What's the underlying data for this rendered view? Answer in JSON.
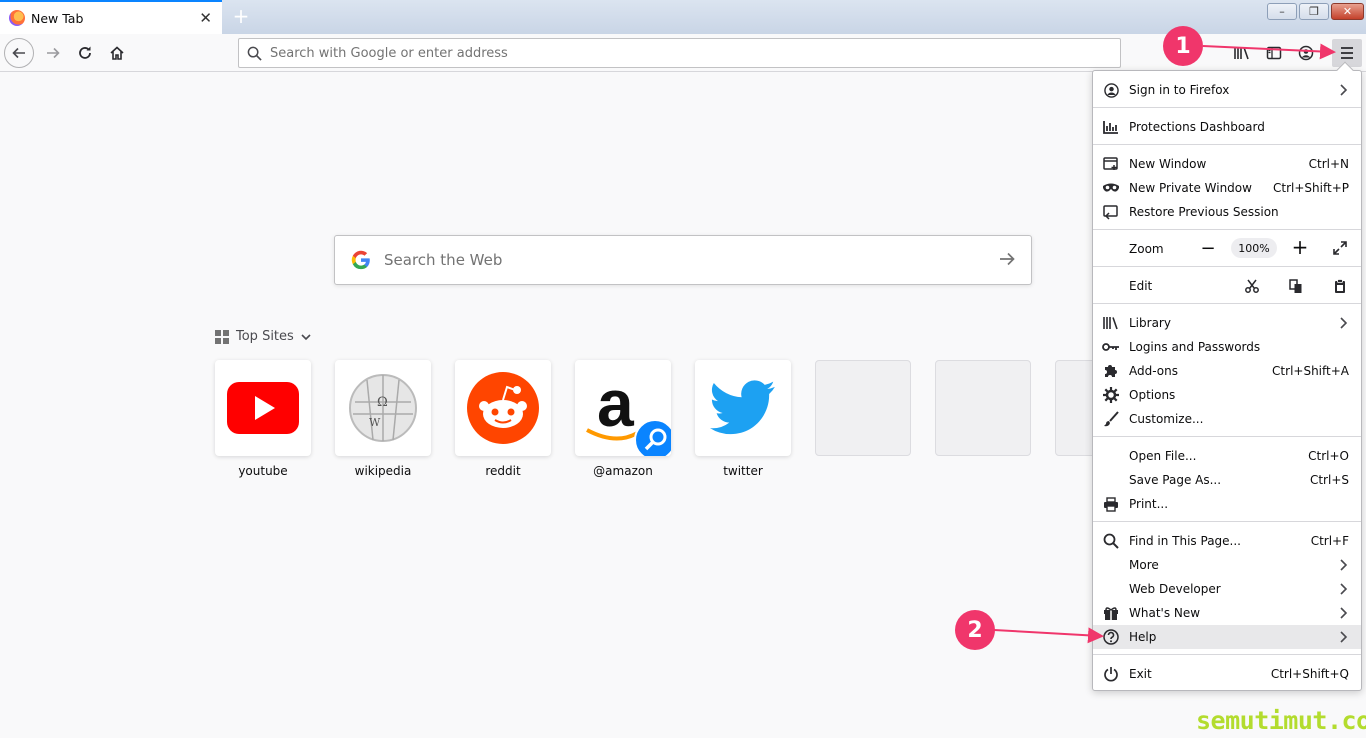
{
  "tab": {
    "title": "New Tab",
    "close": "✕",
    "new_tab": "+"
  },
  "window_controls": {
    "minimize": "–",
    "maximize": "❐",
    "close": "✕"
  },
  "urlbar": {
    "placeholder": "Search with Google or enter address",
    "value": ""
  },
  "search": {
    "placeholder": "Search the Web"
  },
  "top_sites": {
    "heading": "Top Sites",
    "tiles": [
      {
        "label": "youtube",
        "icon": "youtube-icon"
      },
      {
        "label": "wikipedia",
        "icon": "wikipedia-icon"
      },
      {
        "label": "reddit",
        "icon": "reddit-icon"
      },
      {
        "label": "@amazon",
        "icon": "amazon-icon"
      },
      {
        "label": "twitter",
        "icon": "twitter-icon"
      }
    ]
  },
  "menu": {
    "sign_in": "Sign in to Firefox",
    "protections": "Protections Dashboard",
    "new_window": {
      "label": "New Window",
      "shortcut": "Ctrl+N"
    },
    "new_private": {
      "label": "New Private Window",
      "shortcut": "Ctrl+Shift+P"
    },
    "restore": "Restore Previous Session",
    "zoom": {
      "label": "Zoom",
      "minus": "−",
      "value": "100%",
      "plus": "+"
    },
    "edit": "Edit",
    "library": "Library",
    "logins": "Logins and Passwords",
    "addons": {
      "label": "Add-ons",
      "shortcut": "Ctrl+Shift+A"
    },
    "options": "Options",
    "customize": "Customize...",
    "open_file": {
      "label": "Open File...",
      "shortcut": "Ctrl+O"
    },
    "save_page": {
      "label": "Save Page As...",
      "shortcut": "Ctrl+S"
    },
    "print": "Print...",
    "find": {
      "label": "Find in This Page...",
      "shortcut": "Ctrl+F"
    },
    "more": "More",
    "web_developer": "Web Developer",
    "whats_new": "What's New",
    "help": "Help",
    "exit": {
      "label": "Exit",
      "shortcut": "Ctrl+Shift+Q"
    }
  },
  "annotations": {
    "step1": "1",
    "step2": "2"
  },
  "watermark": "semutimut.com",
  "colors": {
    "accent": "#0a84ff",
    "annotation": "#f0366b",
    "watermark": "#b3dc2e"
  }
}
